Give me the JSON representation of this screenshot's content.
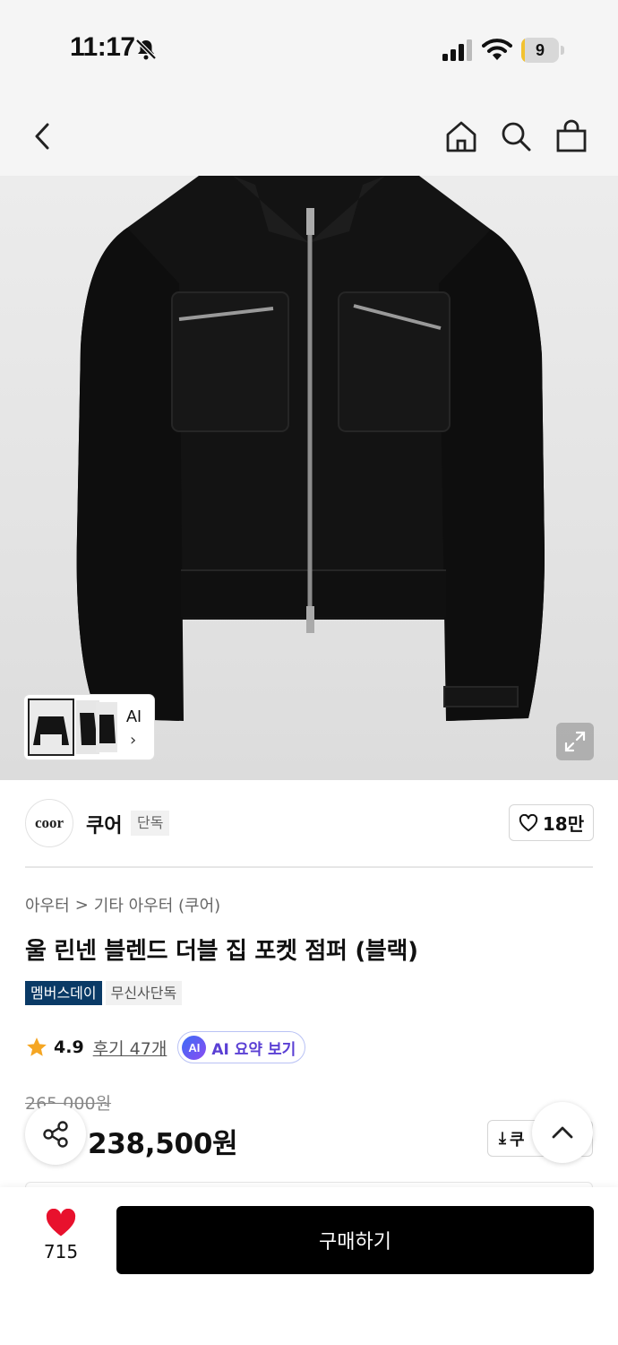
{
  "status_bar": {
    "time": "11:17",
    "battery": "9",
    "battery_level_percent": 9,
    "icons": [
      "bell-off-icon",
      "signal-icon",
      "wifi-icon",
      "battery-icon"
    ]
  },
  "nav": {
    "icons": [
      "back-icon",
      "home-icon",
      "search-icon",
      "shopping-bag-icon"
    ]
  },
  "gallery": {
    "thumbnail_label": "AI",
    "thumbnail_arrow": "›"
  },
  "brand": {
    "logo_text": "coor",
    "name": "쿠어",
    "badge": "단독",
    "like_count": "18만"
  },
  "product": {
    "category_parent": "아우터",
    "category_sep": ">",
    "category_child": "기타 아우터 (쿠어)",
    "title": "울 린넨 블렌드 더블 집 포켓 점퍼 (블랙)",
    "tags": [
      "멤버스데이",
      "무신사단독"
    ],
    "rating": "4.9",
    "review_link": "후기 47개",
    "ai_badge": "AI",
    "ai_summary": "AI 요약 보기",
    "original_price": "265,000원",
    "sale_price": "238,500원",
    "coupon_label": "쿠",
    "coupon_icon": "⤓"
  },
  "bottom_bar": {
    "wish_count": "715",
    "buy_label": "구매하기"
  },
  "colors": {
    "accent_tag": "#0a3a66",
    "heart": "#e8112d",
    "star": "#f5a623",
    "buy_button": "#000000"
  }
}
